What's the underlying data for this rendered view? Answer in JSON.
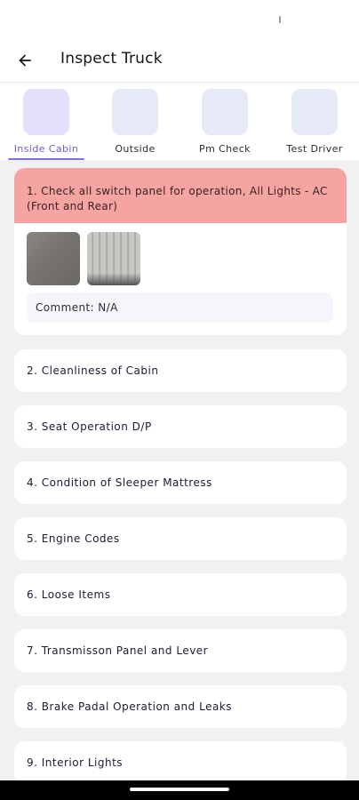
{
  "header": {
    "title": "Inspect Truck"
  },
  "tabs": [
    {
      "label": "Inside Cabin",
      "active": true
    },
    {
      "label": "Outside",
      "active": false
    },
    {
      "label": "Pm Check",
      "active": false
    },
    {
      "label": "Test Driver",
      "active": false
    }
  ],
  "expanded_item": {
    "title": "1. Check all switch panel for operation, All Lights - AC (Front and Rear)",
    "comment": "Comment: N/A",
    "status_color": "#f6a4a2"
  },
  "checklist": [
    "2. Cleanliness of Cabin",
    "3. Seat Operation D/P",
    "4. Condition of Sleeper Mattress",
    "5. Engine Codes",
    "6. Loose Items",
    "7. Transmisson Panel and Lever",
    "8. Brake Padal Operation and Leaks",
    "9. Interior Lights"
  ],
  "icons": {
    "back": "arrow-left-icon"
  },
  "colors": {
    "accent": "#7d74d6",
    "tile": "#e6e9f6",
    "background": "#f1f1f1"
  }
}
